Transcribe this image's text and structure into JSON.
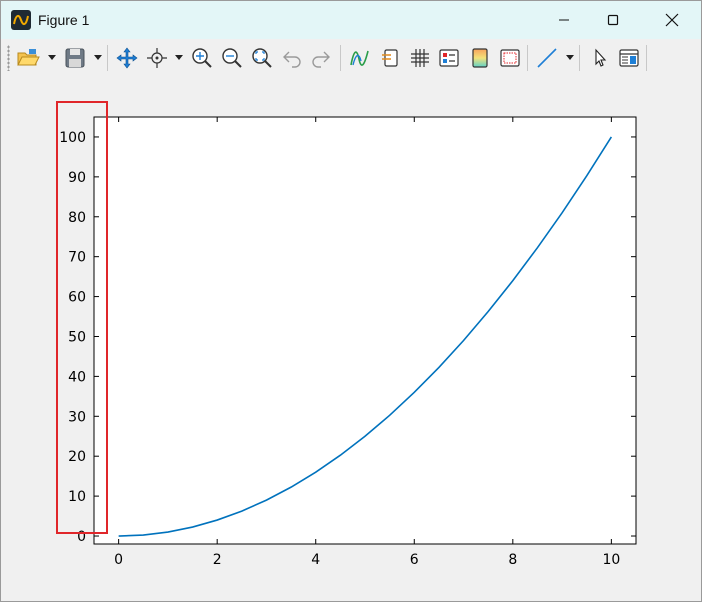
{
  "window": {
    "title": "Figure 1"
  },
  "toolbar": {
    "buttons": [
      {
        "name": "open-icon",
        "label": "Open"
      },
      {
        "name": "save-icon",
        "label": "Save"
      },
      {
        "name": "pan-icon",
        "label": "Pan"
      },
      {
        "name": "rotate-icon",
        "label": "Rotate"
      },
      {
        "name": "zoom-in-icon",
        "label": "Zoom in"
      },
      {
        "name": "zoom-out-icon",
        "label": "Zoom out"
      },
      {
        "name": "zoom-fit-icon",
        "label": "Fit"
      },
      {
        "name": "undo-icon",
        "label": "Undo"
      },
      {
        "name": "redo-icon",
        "label": "Redo"
      },
      {
        "name": "plot-style-icon",
        "label": "Style"
      },
      {
        "name": "colorbar-icon",
        "label": "Colorbar"
      },
      {
        "name": "grid-icon",
        "label": "Grid"
      },
      {
        "name": "legend-icon",
        "label": "Legend"
      },
      {
        "name": "colormap-icon",
        "label": "Colormap"
      },
      {
        "name": "frame-icon",
        "label": "Frame"
      },
      {
        "name": "line-icon",
        "label": "Line"
      },
      {
        "name": "select-cursor-icon",
        "label": "Select"
      },
      {
        "name": "properties-panel-icon",
        "label": "Properties"
      }
    ]
  },
  "colors": {
    "line": "#0072bd",
    "highlight_box": "#e0262a",
    "titlebar": "#e3f6f7"
  },
  "chart_data": {
    "type": "line",
    "title": "",
    "xlabel": "",
    "ylabel": "",
    "xlim": [
      -0.5,
      10.5
    ],
    "ylim": [
      -2,
      105
    ],
    "xticks": [
      0,
      2,
      4,
      6,
      8,
      10
    ],
    "yticks": [
      0,
      10,
      20,
      30,
      40,
      50,
      60,
      70,
      80,
      90,
      100
    ],
    "grid": false,
    "series": [
      {
        "x": [
          0,
          0.5,
          1,
          1.5,
          2,
          2.5,
          3,
          3.5,
          4,
          4.5,
          5,
          5.5,
          6,
          6.5,
          7,
          7.5,
          8,
          8.5,
          9,
          9.5,
          10
        ],
        "y": [
          0,
          0.25,
          1,
          2.25,
          4,
          6.25,
          9,
          12.25,
          16,
          20.25,
          25,
          30.25,
          36,
          42.25,
          49,
          56.25,
          64,
          72.25,
          81,
          90.25,
          100
        ]
      }
    ]
  }
}
